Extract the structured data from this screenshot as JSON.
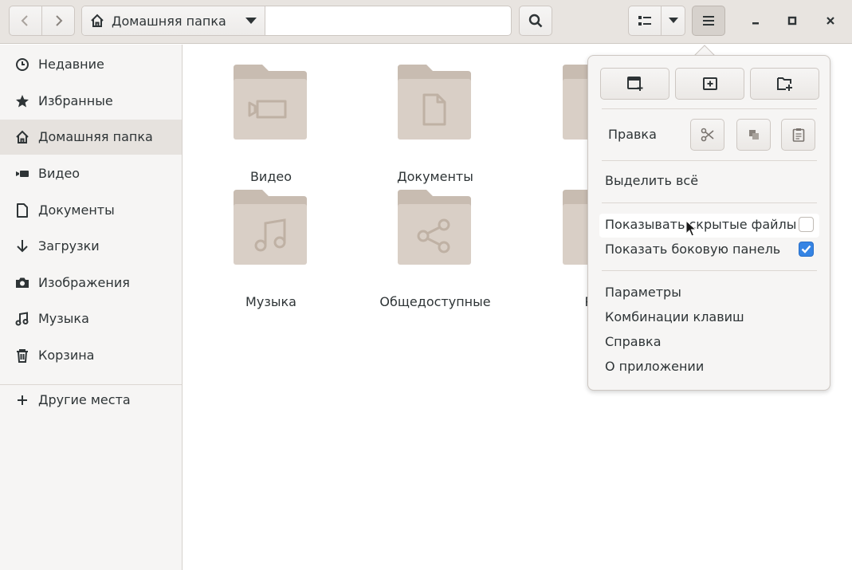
{
  "headerbar": {
    "path_label": "Домашняя папка"
  },
  "sidebar": {
    "items": [
      {
        "label": "Недавние",
        "icon": "clock-icon"
      },
      {
        "label": "Избранные",
        "icon": "star-icon"
      },
      {
        "label": "Домашняя папка",
        "icon": "home-icon",
        "active": true
      },
      {
        "label": "Видео",
        "icon": "video-icon"
      },
      {
        "label": "Документы",
        "icon": "document-icon"
      },
      {
        "label": "Загрузки",
        "icon": "download-icon"
      },
      {
        "label": "Изображения",
        "icon": "camera-icon"
      },
      {
        "label": "Музыка",
        "icon": "music-icon"
      },
      {
        "label": "Корзина",
        "icon": "trash-icon"
      }
    ],
    "other_places": "Другие места"
  },
  "folders": [
    {
      "label": "Видео",
      "icon": "video-icon"
    },
    {
      "label": "Документы",
      "icon": "document-icon"
    },
    {
      "label": "За",
      "icon": "download-icon"
    },
    {
      "label": "Музыка",
      "icon": "music-icon"
    },
    {
      "label": "Общедоступные",
      "icon": "share-icon"
    },
    {
      "label": "Рабо",
      "icon": "template-icon"
    }
  ],
  "menu": {
    "edit_label": "Правка",
    "select_all": "Выделить всё",
    "show_hidden": "Показывать скрытые файлы",
    "show_hidden_checked": false,
    "show_sidebar": "Показать боковую панель",
    "show_sidebar_checked": true,
    "preferences": "Параметры",
    "shortcuts": "Комбинации клавиш",
    "help": "Справка",
    "about": "О приложении"
  },
  "colors": {
    "folder": "#d8cdc3",
    "folder_tab": "#c7b9ad",
    "accent": "#3584e4"
  }
}
